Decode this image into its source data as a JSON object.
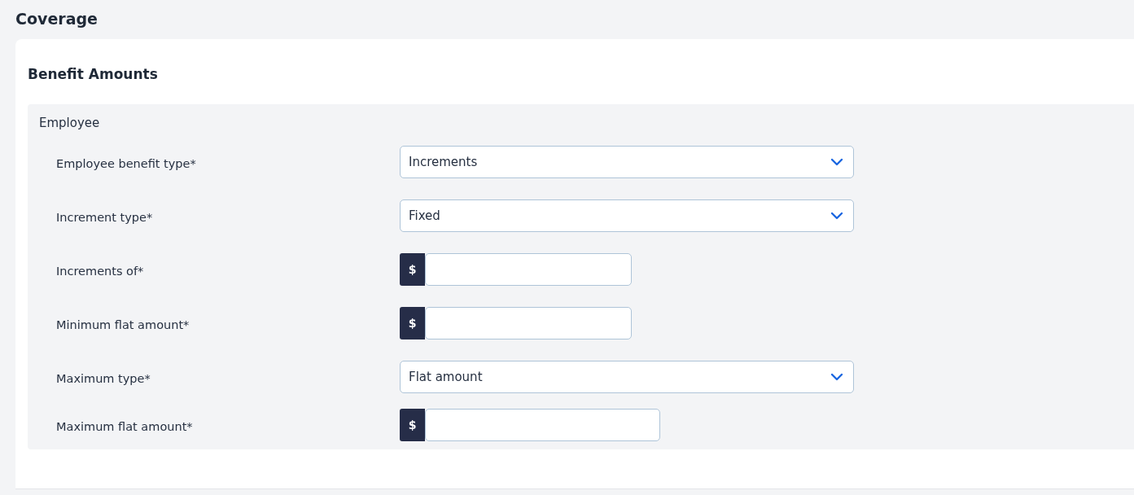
{
  "page_title": "Coverage",
  "card": {
    "title": "Benefit Amounts",
    "section": {
      "title": "Employee",
      "fields": [
        {
          "label": "Employee benefit type*",
          "kind": "select",
          "value": "Increments"
        },
        {
          "label": "Increment type*",
          "kind": "select",
          "value": "Fixed"
        },
        {
          "label": "Increments of*",
          "kind": "currency",
          "prefix": "$"
        },
        {
          "label": "Minimum flat amount*",
          "kind": "currency",
          "prefix": "$"
        },
        {
          "label": "Maximum type*",
          "kind": "select",
          "value": "Flat amount"
        },
        {
          "label": "Maximum flat amount*",
          "kind": "currency",
          "prefix": "$"
        }
      ]
    }
  }
}
